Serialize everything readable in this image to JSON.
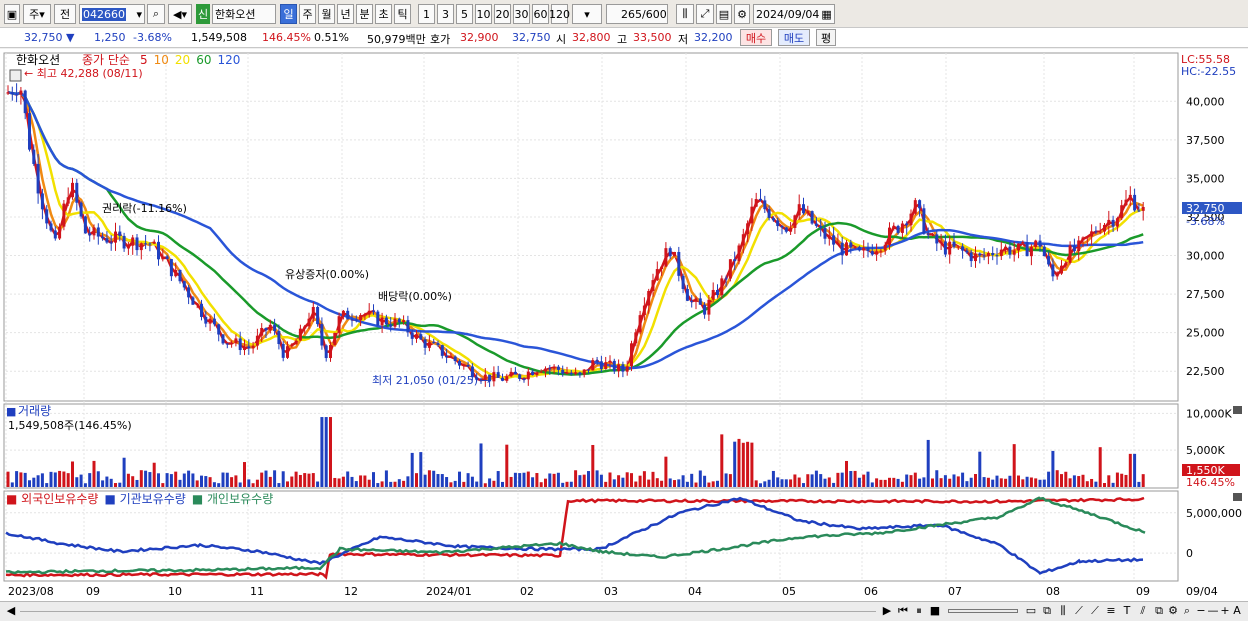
{
  "toolbar": {
    "mode1": "주",
    "mode2": "전",
    "code": "042660",
    "name": "한화오션",
    "badge": "신",
    "periods": [
      "일",
      "주",
      "월",
      "년",
      "분",
      "초",
      "틱"
    ],
    "minutes": [
      "1",
      "3",
      "5",
      "10",
      "20",
      "30",
      "60",
      "120"
    ],
    "count": "265",
    "count_max": "/600",
    "date": "2024/09/04"
  },
  "quote": {
    "price": "32,750",
    "arrow": "▼",
    "change": "1,250",
    "change_pct": "-3.68%",
    "volume": "1,549,508",
    "volume_pct": "146.45%",
    "turnover": "0.51%",
    "amount": "50,979백만",
    "bid_label": "호가",
    "bid": "32,900",
    "ask": "32,750",
    "open_label": "시",
    "open": "32,800",
    "high_label": "고",
    "high": "33,500",
    "low_label": "저",
    "low": "32,200",
    "buy": "매수",
    "sell": "매도",
    "eval": "평"
  },
  "price_panel": {
    "title": "한화오션",
    "ma_label": "종가 단순",
    "ma_periods": [
      "5",
      "10",
      "20",
      "60",
      "120"
    ],
    "ma_colors": [
      "#d0141b",
      "#f08a12",
      "#f2e000",
      "#1a9a2a",
      "#2a55d8"
    ],
    "lc": "LC:55.58",
    "hc": "HC:-22.55",
    "high_mark": "최고 42,288 (08/11)",
    "low_mark": "최저 21,050 (01/25)",
    "events": [
      "권리락(-11.16%)",
      "유상증자(0.00%)",
      "배당락(0.00%)"
    ],
    "y_ticks": [
      "40,000",
      "37,500",
      "35,000",
      "32,500",
      "30,000",
      "27,500",
      "25,000",
      "22,500"
    ],
    "current_label": "32,750",
    "current_pct": "-3.68%"
  },
  "volume_panel": {
    "title": "거래량",
    "value": "1,549,508주(146.45%)",
    "y_ticks": [
      "10,000K",
      "5,000K"
    ],
    "current_label": "1,550K",
    "current_pct": "146.45%"
  },
  "holding_panel": {
    "legend": [
      "외국인보유수량",
      "기관보유수량",
      "개인보유수량"
    ],
    "colors": [
      "#d0141b",
      "#1f3fbf",
      "#2a8a5a"
    ],
    "y_ticks": [
      "5,000,000",
      "0"
    ]
  },
  "x_axis": [
    "2023/08",
    "09",
    "10",
    "11",
    "12",
    "2024/01",
    "02",
    "03",
    "04",
    "05",
    "06",
    "07",
    "08",
    "09",
    "09/04"
  ]
}
